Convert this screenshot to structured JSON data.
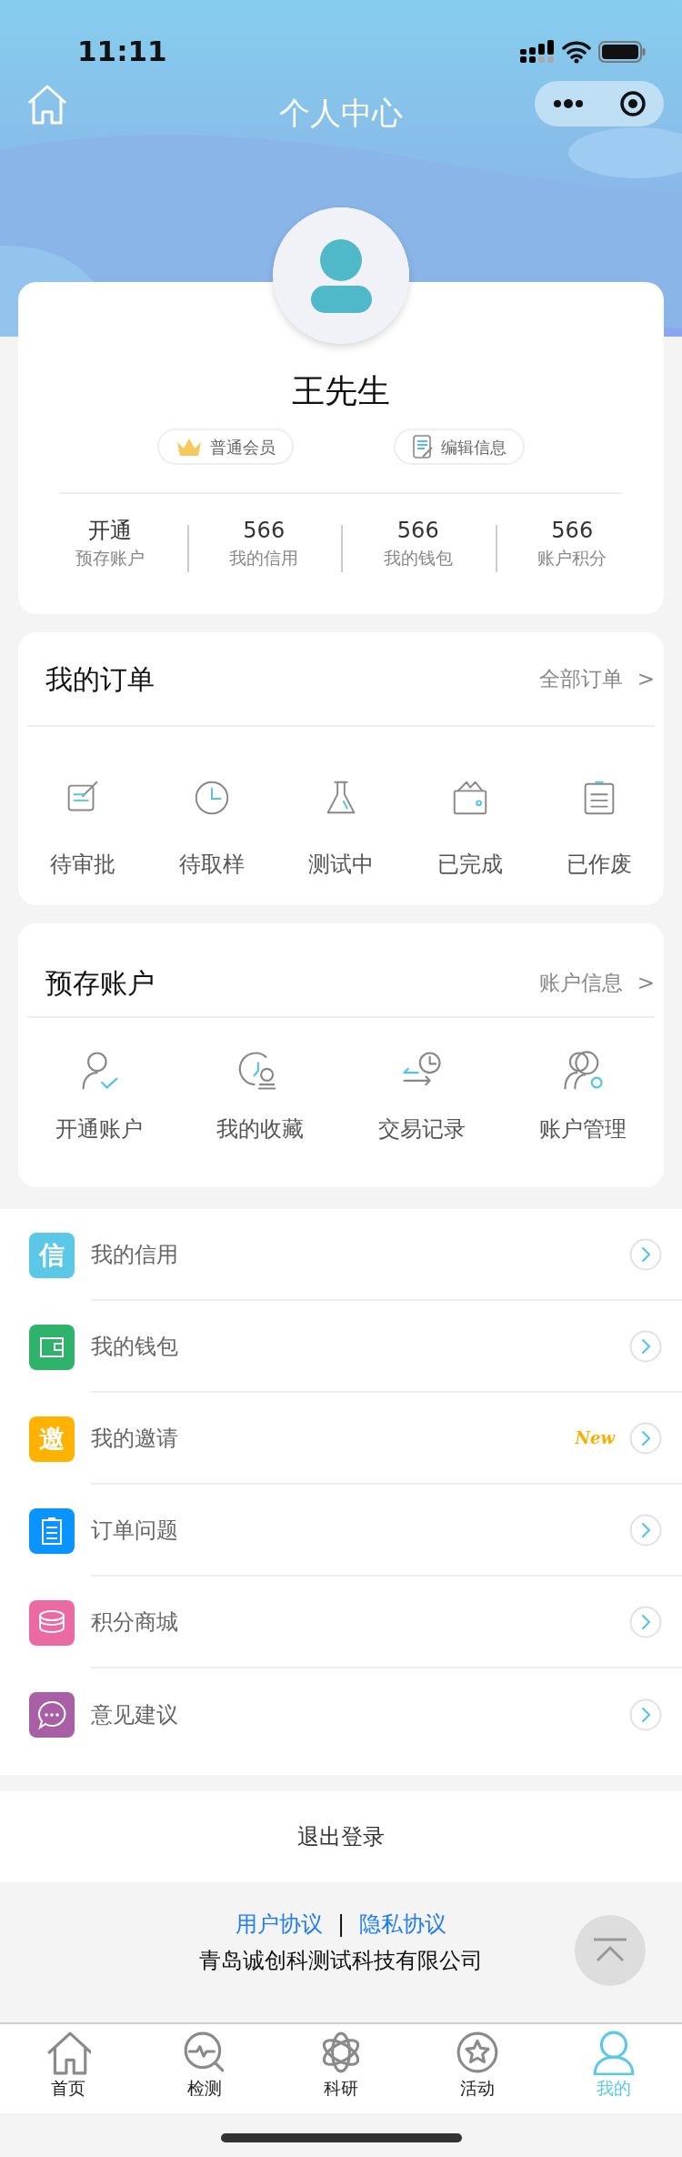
{
  "status_bar": {
    "time": "11:11"
  },
  "nav": {
    "title": "个人中心"
  },
  "profile": {
    "name": "王先生",
    "badges": [
      {
        "kind": "member",
        "label": "普通会员"
      },
      {
        "kind": "edit",
        "label": "编辑信息"
      }
    ],
    "stats": [
      {
        "value": "开通",
        "label": "预存账户"
      },
      {
        "value": "566",
        "label": "我的信用"
      },
      {
        "value": "566",
        "label": "我的钱包"
      },
      {
        "value": "566",
        "label": "账户积分"
      }
    ]
  },
  "orders": {
    "title": "我的订单",
    "link": "全部订单",
    "arrow": ">",
    "items": [
      {
        "kind": "edit",
        "label": "待审批"
      },
      {
        "kind": "clock",
        "label": "待取样"
      },
      {
        "kind": "flask",
        "label": "测试中"
      },
      {
        "kind": "wallet",
        "label": "已完成"
      },
      {
        "kind": "clipboard",
        "label": "已作废"
      }
    ]
  },
  "account": {
    "title": "预存账户",
    "link": "账户信息",
    "arrow": ">",
    "items": [
      {
        "kind": "user-check",
        "label": "开通账户"
      },
      {
        "kind": "stamp",
        "label": "我的收藏"
      },
      {
        "kind": "transfer",
        "label": "交易记录"
      },
      {
        "kind": "users-gear",
        "label": "账户管理"
      }
    ]
  },
  "menu": [
    {
      "kind": "glyph",
      "glyph": "信",
      "color": "#5bc8e8",
      "label": "我的信用"
    },
    {
      "kind": "wallet",
      "color": "#2fb26a",
      "label": "我的钱包"
    },
    {
      "kind": "glyph",
      "glyph": "邀",
      "color": "#ffb300",
      "label": "我的邀请",
      "badge": "New"
    },
    {
      "kind": "clipboard",
      "color": "#0a94ff",
      "label": "订单问题"
    },
    {
      "kind": "coins",
      "color": "#ec6aa3",
      "label": "积分商城"
    },
    {
      "kind": "chat",
      "color": "#a95fa6",
      "label": "意见建议"
    }
  ],
  "logout": "退出登录",
  "footer": {
    "links": [
      "用户协议",
      "隐私协议"
    ],
    "separator": "|",
    "company": "青岛诚创科测试科技有限公司"
  },
  "tabbar": [
    {
      "kind": "home",
      "label": "首页",
      "selected": false
    },
    {
      "kind": "scan",
      "label": "检测",
      "selected": false
    },
    {
      "kind": "atom",
      "label": "科研",
      "selected": false
    },
    {
      "kind": "star",
      "label": "活动",
      "selected": false
    },
    {
      "kind": "user",
      "label": "我的",
      "selected": true
    }
  ]
}
